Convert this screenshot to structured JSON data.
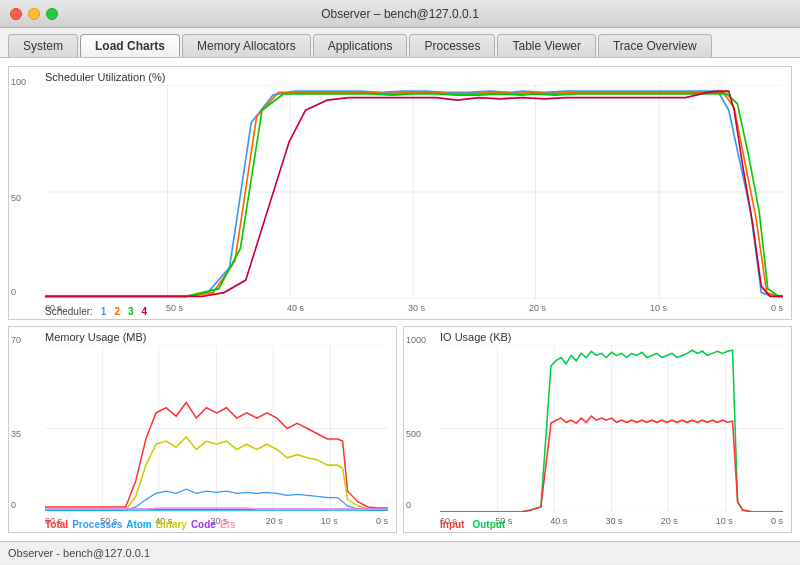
{
  "window": {
    "title": "Observer – bench@127.0.0.1"
  },
  "tabs": [
    {
      "id": "system",
      "label": "System",
      "active": false
    },
    {
      "id": "load-charts",
      "label": "Load Charts",
      "active": true
    },
    {
      "id": "memory-allocators",
      "label": "Memory Allocators",
      "active": false
    },
    {
      "id": "applications",
      "label": "Applications",
      "active": false
    },
    {
      "id": "processes",
      "label": "Processes",
      "active": false
    },
    {
      "id": "table-viewer",
      "label": "Table Viewer",
      "active": false
    },
    {
      "id": "trace-overview",
      "label": "Trace Overview",
      "active": false
    }
  ],
  "charts": {
    "scheduler": {
      "title": "Scheduler Utilization (%)",
      "y_max": "100",
      "y_mid": "50",
      "y_min": "0",
      "x_labels": [
        "60 s",
        "50 s",
        "40 s",
        "30 s",
        "20 s",
        "10 s",
        "0 s"
      ],
      "legend_label": "Scheduler:",
      "legend_items": [
        {
          "label": "1",
          "color": "#3399ff"
        },
        {
          "label": "2",
          "color": "#ff6600"
        },
        {
          "label": "3",
          "color": "#00cc00"
        },
        {
          "label": "4",
          "color": "#cc0000"
        }
      ]
    },
    "memory": {
      "title": "Memory Usage (MB)",
      "y_max": "70",
      "y_mid": "35",
      "y_min": "0",
      "x_labels": [
        "60 s",
        "50 s",
        "40 s",
        "30 s",
        "20 s",
        "10 s",
        "0 s"
      ],
      "legend_items": [
        {
          "label": "Total",
          "color": "#ff3333"
        },
        {
          "label": "Processes",
          "color": "#3399ff"
        },
        {
          "label": "Atom",
          "color": "#00aaff"
        },
        {
          "label": "Binary",
          "color": "#cccc00"
        },
        {
          "label": "Code",
          "color": "#9933ff"
        },
        {
          "label": "Ets",
          "color": "#ff99cc"
        }
      ]
    },
    "io": {
      "title": "IO Usage (KB)",
      "y_max": "1000",
      "y_mid": "500",
      "y_min": "0",
      "x_labels": [
        "60 s",
        "50 s",
        "40 s",
        "30 s",
        "20 s",
        "10 s",
        "0 s"
      ],
      "legend_items": [
        {
          "label": "Input",
          "color": "#ff3333"
        },
        {
          "label": "Output",
          "color": "#00cc44"
        }
      ]
    }
  },
  "status_bar": {
    "text": "Observer - bench@127.0.0.1"
  }
}
